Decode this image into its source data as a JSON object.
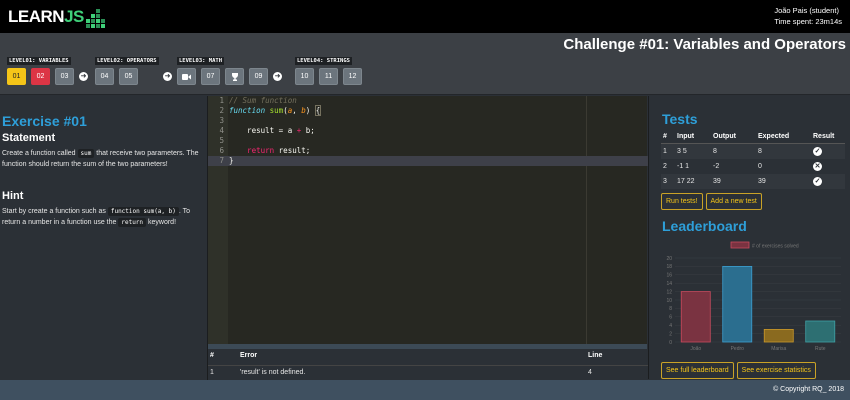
{
  "brand": {
    "learn": "LEARN",
    "js": "JS"
  },
  "user": {
    "name": "João Pais (student)",
    "time_spent": "Time spent: 23m14s"
  },
  "challenge": {
    "title": "Challenge #01: Variables and Operators"
  },
  "levels": [
    {
      "label": "LEVEL01: VARIABLES",
      "buttons": [
        "01",
        "02",
        "03"
      ]
    },
    {
      "label": "LEVEL02: OPERATORS",
      "buttons": [
        "04",
        "05"
      ]
    },
    {
      "label": "LEVEL03: MATH",
      "buttons": [
        "07",
        "09"
      ]
    },
    {
      "label": "LEVEL04: STRINGS",
      "buttons": [
        "10",
        "11",
        "12"
      ]
    }
  ],
  "icons": {
    "arrow": "arrow-right-circle-icon",
    "video": "video-camera-icon",
    "trophy": "trophy-icon",
    "check": "check-circle-icon",
    "error": "x-circle-icon"
  },
  "colors": {
    "accent": "#2e9fd9",
    "yellow": "#f5c518",
    "red": "#dc3545",
    "logo_green": "#3fd07a"
  },
  "exercise": {
    "title": "Exercise #01",
    "statement_heading": "Statement",
    "statement_pre": "Create a function called",
    "statement_code": "sum",
    "statement_post": "that receive two parameters. The function should return the sum of the two parameters!",
    "hint_heading": "Hint",
    "hint_pre": "Start by create a function such as",
    "hint_code": "function sum(a, b)",
    "hint_mid": ". To return a number in a function use the",
    "hint_code2": "return",
    "hint_post": "keyword!"
  },
  "editor": {
    "line_numbers": [
      "1",
      "2",
      "3",
      "4",
      "5",
      "6",
      "7"
    ],
    "l1": "// Sum function",
    "l2_kw": "function",
    "l2_fn": "sum",
    "l2_open": "(",
    "l2_a": "a",
    "l2_comma": ", ",
    "l2_b": "b",
    "l2_close": ") ",
    "l2_brace": "{",
    "l4_pre": "    result = a ",
    "l4_op": "+",
    "l4_post": " b;",
    "l6_kw": "    return",
    "l6_post": " result;",
    "l7": "}"
  },
  "errors": {
    "headers": {
      "num": "#",
      "error": "Error",
      "line": "Line"
    },
    "rows": [
      {
        "num": "1",
        "error": "'result' is not defined.",
        "line": "4"
      }
    ]
  },
  "tests": {
    "title": "Tests",
    "headers": [
      "#",
      "Input",
      "Output",
      "Expected",
      "Result"
    ],
    "rows": [
      {
        "num": "1",
        "input": "3 5",
        "output": "8",
        "expected": "8",
        "result": "pass"
      },
      {
        "num": "2",
        "input": "-1 1",
        "output": "-2",
        "expected": "0",
        "result": "fail"
      },
      {
        "num": "3",
        "input": "17 22",
        "output": "39",
        "expected": "39",
        "result": "pass"
      }
    ],
    "run_button": "Run tests!",
    "add_button": "Add a new test"
  },
  "leaderboard": {
    "title": "Leaderboard",
    "full_button": "See full leaderboard",
    "stats_button": "See exercise statistics"
  },
  "chart_data": {
    "type": "bar",
    "categories": [
      "João",
      "Pedro",
      "Marisa",
      "Rute"
    ],
    "series": [
      {
        "name": "# of exercises solved",
        "values": [
          12,
          18,
          3,
          5
        ]
      }
    ],
    "bar_colors": [
      "#7a3341",
      "#2b6e8f",
      "#8a6a1f",
      "#2d6f72"
    ],
    "bar_borders": [
      "#c94a5e",
      "#3d9fd0",
      "#c9982b",
      "#3fa0a5"
    ],
    "ylim": [
      0,
      20
    ],
    "yticks": [
      "0",
      "2",
      "4",
      "6",
      "8",
      "10",
      "12",
      "14",
      "16",
      "18",
      "20"
    ]
  },
  "footer": {
    "copyright": "© Copyright RQ_ 2018"
  }
}
